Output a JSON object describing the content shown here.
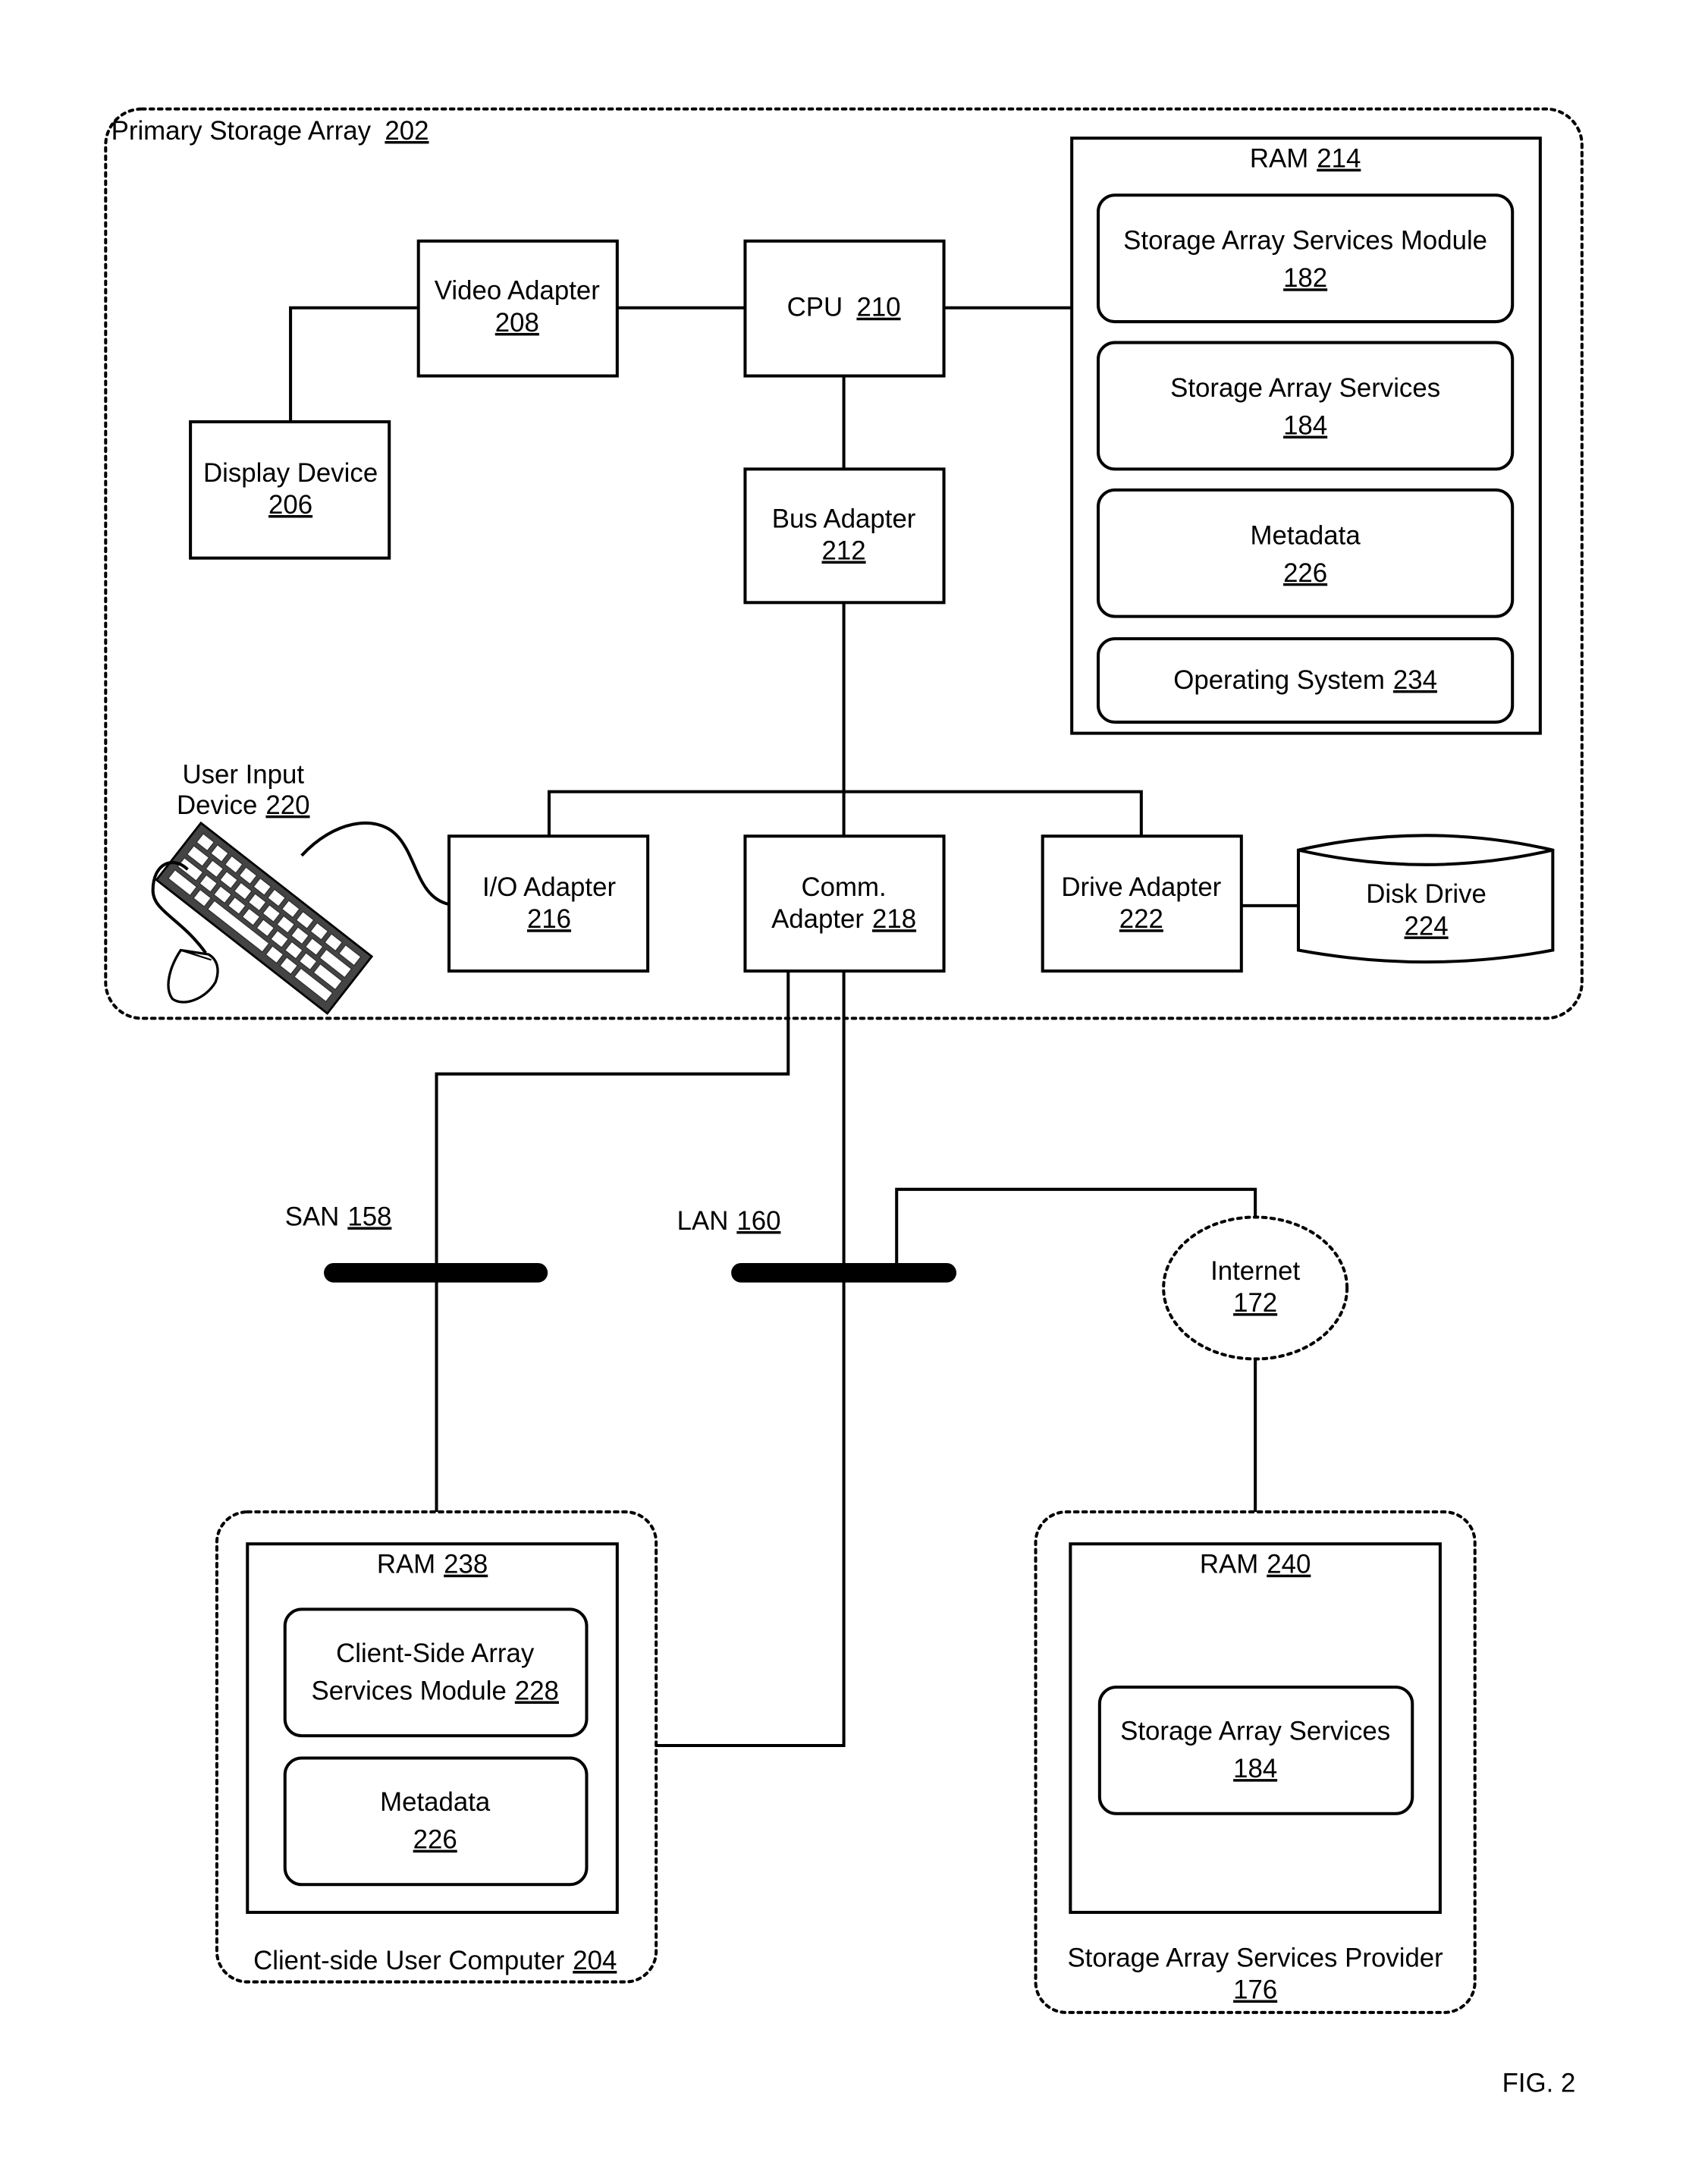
{
  "figure_label": "FIG. 2",
  "primary_storage_array": {
    "label": "Primary Storage Array",
    "ref": "202"
  },
  "video_adapter": {
    "label": "Video Adapter",
    "ref": "208"
  },
  "cpu": {
    "label": "CPU",
    "ref": "210"
  },
  "display_device": {
    "label": "Display Device",
    "ref": "206"
  },
  "bus_adapter": {
    "label": "Bus Adapter",
    "ref": "212"
  },
  "ram_214": {
    "label": "RAM",
    "ref": "214",
    "items": [
      {
        "label": "Storage Array Services Module",
        "ref": "182"
      },
      {
        "label": "Storage Array Services",
        "ref": "184"
      },
      {
        "label": "Metadata",
        "ref": "226"
      },
      {
        "label": "Operating System",
        "ref": "234"
      }
    ]
  },
  "user_input_device": {
    "label_line1": "User Input",
    "label_line2": "Device",
    "ref": "220"
  },
  "io_adapter": {
    "label": "I/O Adapter",
    "ref": "216"
  },
  "comm_adapter": {
    "label_line1": "Comm.",
    "label_line2": "Adapter",
    "ref": "218"
  },
  "drive_adapter": {
    "label": "Drive Adapter",
    "ref": "222"
  },
  "disk_drive": {
    "label": "Disk Drive",
    "ref": "224"
  },
  "san": {
    "label": "SAN",
    "ref": "158"
  },
  "lan": {
    "label": "LAN",
    "ref": "160"
  },
  "internet": {
    "label": "Internet",
    "ref": "172"
  },
  "client_computer": {
    "label": "Client-side User Computer",
    "ref": "204",
    "ram": {
      "label": "RAM",
      "ref": "238",
      "items": [
        {
          "label_line1": "Client-Side Array",
          "label_line2": "Services Module",
          "ref": "228"
        },
        {
          "label": "Metadata",
          "ref": "226"
        }
      ]
    }
  },
  "services_provider": {
    "label": "Storage Array Services Provider",
    "ref": "176",
    "ram": {
      "label": "RAM",
      "ref": "240",
      "items": [
        {
          "label": "Storage Array Services",
          "ref": "184"
        }
      ]
    }
  }
}
